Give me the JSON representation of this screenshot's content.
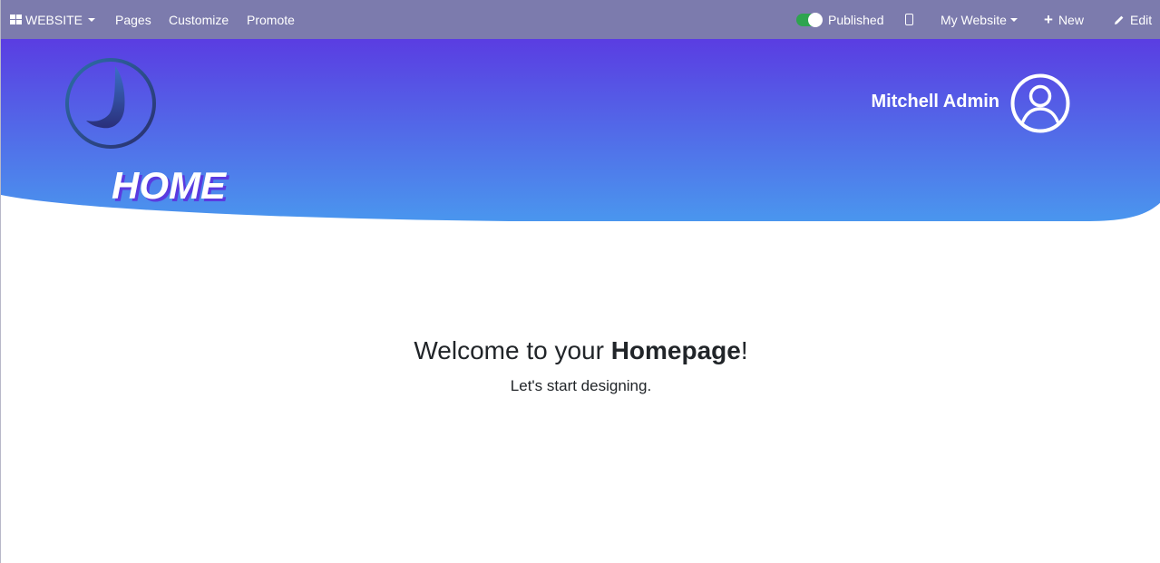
{
  "topbar": {
    "apps_label": "WEBSITE",
    "menu": [
      "Pages",
      "Customize",
      "Promote"
    ],
    "published_label": "Published",
    "website_label": "My Website",
    "new_label": "New",
    "edit_label": "Edit",
    "bg_color": "#7c7bad",
    "toggle_color": "#2ea44f"
  },
  "hero": {
    "title": "HOME",
    "user_name": "Mitchell Admin",
    "gradient_top": "#5a3de2",
    "gradient_bottom": "#4a96ee"
  },
  "content": {
    "welcome_prefix": "Welcome to your ",
    "welcome_bold": "Homepage",
    "welcome_suffix": "!",
    "subtitle": "Let's start designing."
  },
  "icons": {
    "apps": "apps-grid-icon",
    "phone": "mobile-preview-icon",
    "plus": "plus-icon",
    "pencil": "pencil-icon",
    "avatar": "user-circle-icon"
  }
}
